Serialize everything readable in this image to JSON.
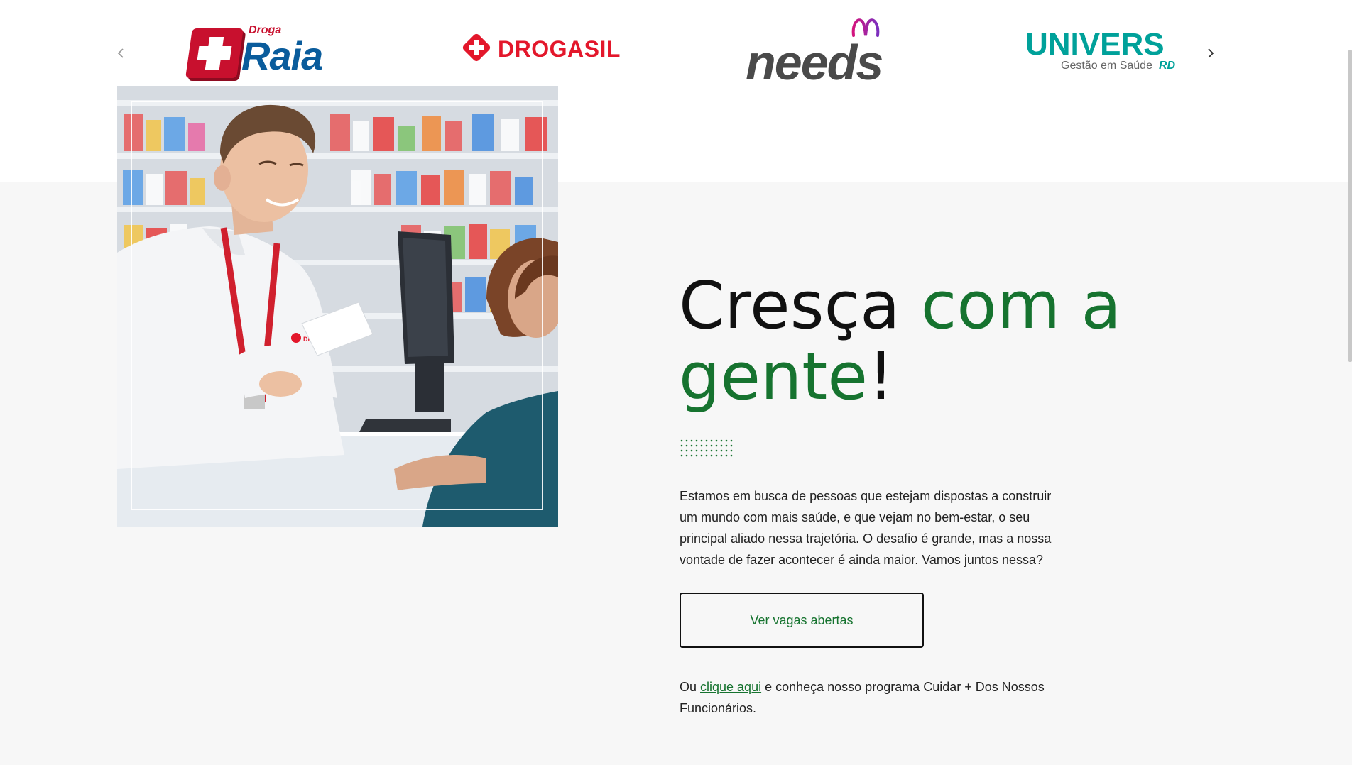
{
  "carousel": {
    "prev_icon": "chevron-left-icon",
    "next_icon": "chevron-right-icon",
    "brands": [
      {
        "name": "Raia",
        "label_small": "Droga",
        "color": "#0a5c9c",
        "accent": "#c8102e"
      },
      {
        "name": "DROGASIL",
        "color": "#e3172b"
      },
      {
        "name": "needs",
        "color": "#4a4a4a",
        "accent": "#d3147e"
      },
      {
        "name": "UNIVERS",
        "sub": "Gestão em Saúde",
        "badge": "RD",
        "color": "#00a19a"
      }
    ]
  },
  "hero": {
    "headline_part1": "Cresça ",
    "headline_part2": "com a gente",
    "headline_part3": "!",
    "intro": "Estamos em busca de pessoas que estejam dispostas a construir um mundo com mais saúde, e que vejam no bem-estar, o seu principal aliado nessa trajetória. O desafio é grande, mas a nossa vontade de fazer acontecer é ainda maior. Vamos juntos nessa?",
    "cta_label": "Ver vagas abertas",
    "note_prefix": "Ou ",
    "note_link": "clique aqui",
    "note_suffix": " e conheça nosso programa Cuidar + Dos Nossos Funcionários.",
    "photo_badge": "DROGASIL",
    "accent_color": "#16732f",
    "background": "#f7f7f7"
  }
}
